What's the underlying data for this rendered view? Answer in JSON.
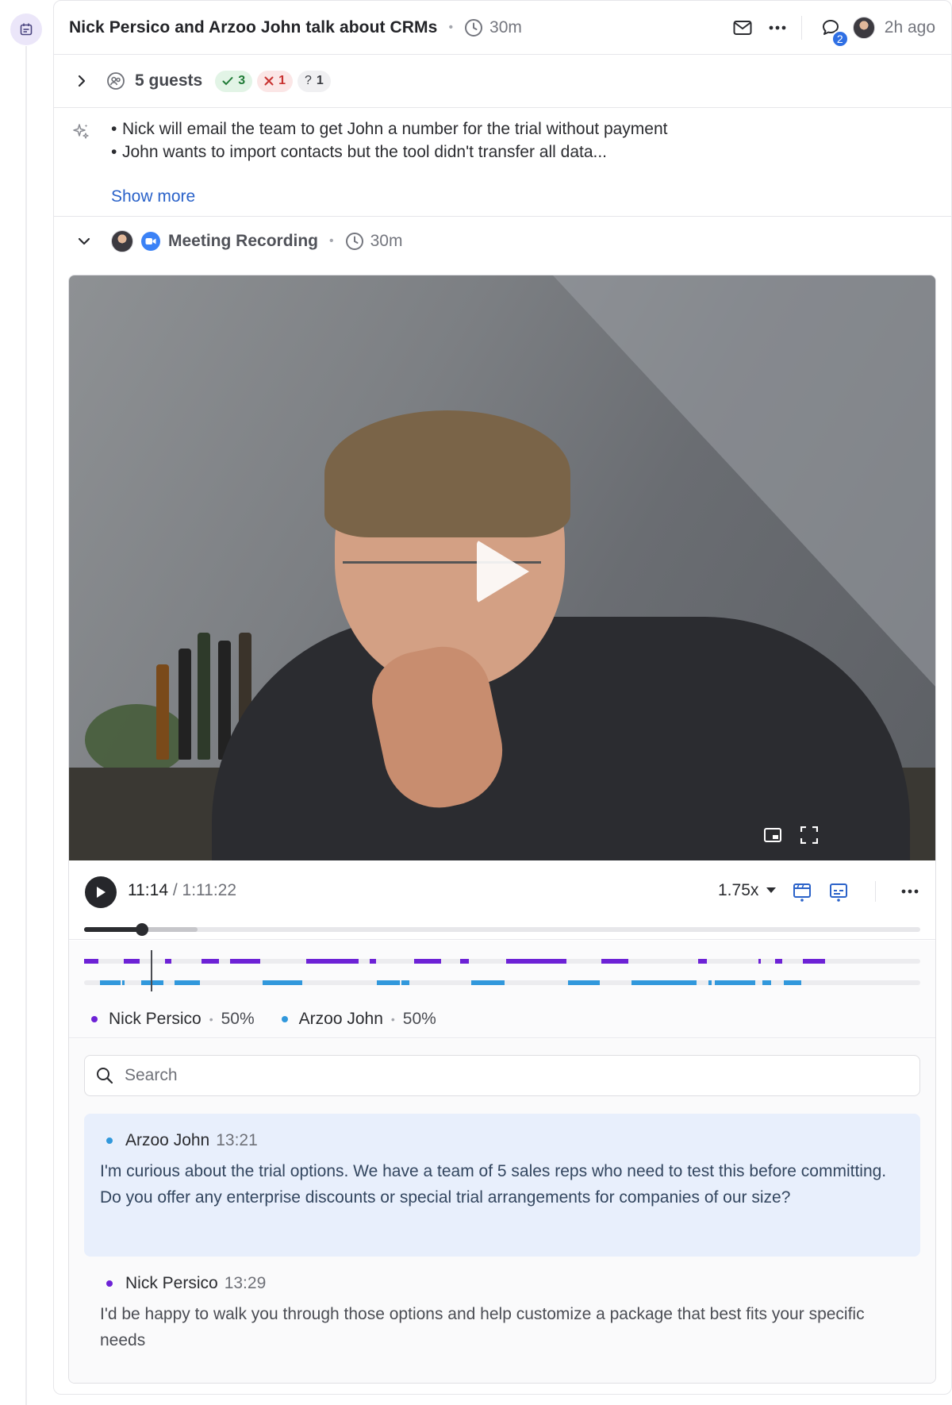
{
  "event": {
    "title": "Nick Persico and Arzoo John talk about CRMs",
    "duration": "30m",
    "comment_count": "2",
    "time_ago": "2h ago"
  },
  "guests": {
    "label": "5 guests",
    "accepted": "3",
    "declined": "1",
    "tentative": "1"
  },
  "summary": {
    "items": [
      "Nick will email the team to get John a number for the trial without payment",
      "John wants to import contacts but the tool didn't transfer all data..."
    ],
    "show_more": "Show more"
  },
  "recording": {
    "title": "Meeting Recording",
    "duration": "30m"
  },
  "player": {
    "current_time": "11:14",
    "total_time": "/ 1:11:22",
    "speed": "1.75x",
    "progress_fraction": 0.0693,
    "buffered_fraction": 0.136
  },
  "speakers": [
    {
      "name": "Nick Persico",
      "share": "50%",
      "color": "#6d22d6"
    },
    {
      "name": "Arzoo John",
      "share": "50%",
      "color": "#3198dc"
    }
  ],
  "transcript": {
    "search_placeholder": "Search",
    "entries": [
      {
        "speaker": "Arzoo John",
        "time": "13:21",
        "color": "#3198dc",
        "text": "I'm curious about the trial options. We have a team of 5 sales reps who need to test this before committing. Do you offer any enterprise discounts or special trial arrangements for companies of our size?"
      },
      {
        "speaker": "Nick Persico",
        "time": "13:29",
        "color": "#6d22d6",
        "text": "I'd be happy to walk you through those options and help customize a package that best fits your specific needs"
      }
    ]
  },
  "icons": {
    "rail": "calendar-icon",
    "duration": "clock-icon",
    "email": "envelope-icon",
    "more": "ellipsis-icon",
    "comments": "comment-icon",
    "guests": "people-icon",
    "summary": "sparkle-icon",
    "meeting_source": "zoom-video-icon",
    "pip": "picture-in-picture-icon",
    "fullscreen": "fullscreen-icon",
    "clips": "clapperboard-icon",
    "captions": "captions-icon"
  }
}
